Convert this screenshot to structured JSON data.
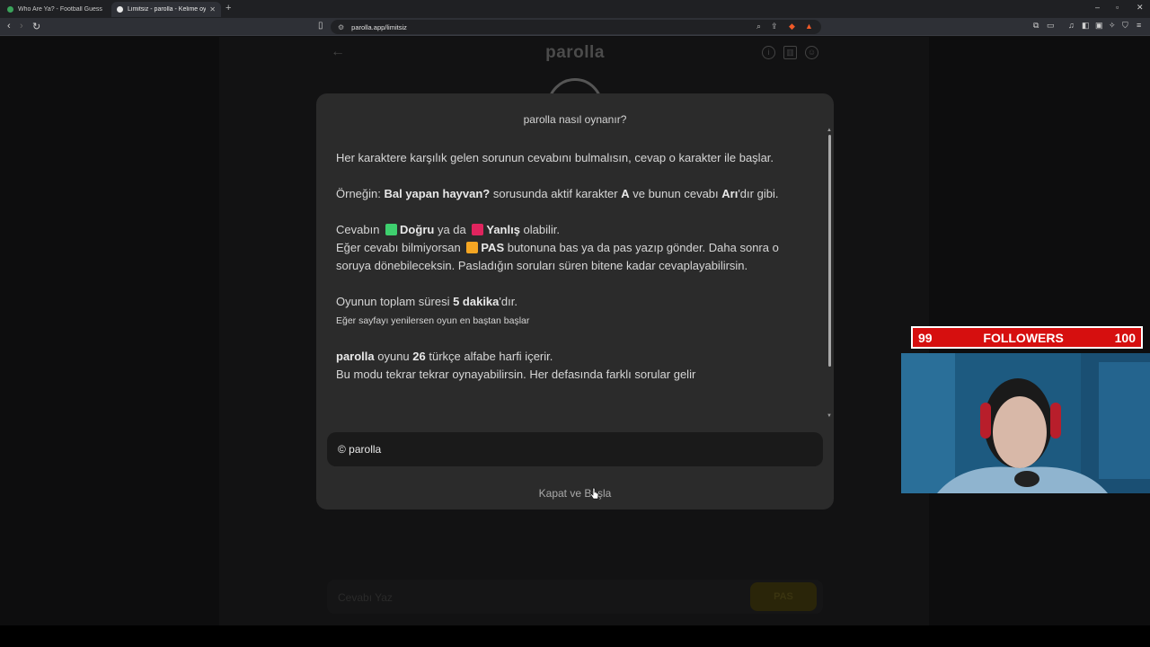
{
  "browser": {
    "tabs": [
      {
        "title": "Who Are Ya? - Football Guesser",
        "active": false
      },
      {
        "title": "Limitsiz - parolla - Kelime oyunu",
        "active": true
      }
    ],
    "url": "parolla.app/limitsiz"
  },
  "app": {
    "logo": "parolla",
    "input_placeholder": "Cevabı Yaz",
    "pas_label": "PAS"
  },
  "modal": {
    "title": "parolla nasıl oynanır?",
    "p1": "Her karaktere karşılık gelen sorunun cevabını bulmalısın, cevap o karakter ile başlar.",
    "p2": {
      "a": "Örneğin: ",
      "b": "Bal yapan hayvan?",
      "c": " sorusunda aktif karakter ",
      "d": "A",
      "e": " ve bunun cevabı ",
      "f": "Arı",
      "g": "'dır gibi."
    },
    "p3": {
      "a": "Cevabın ",
      "b": "Doğru",
      "c": " ya da ",
      "d": "Yanlış",
      "e": " olabilir.",
      "f": "Eğer cevabı bilmiyorsan ",
      "g": "PAS",
      "h": " butonuna bas ya da pas yazıp gönder. Daha sonra o soruya dönebileceksin. Pasladığın soruları süren bitene kadar cevaplayabilirsin."
    },
    "p4": {
      "a": "Oyunun toplam süresi ",
      "b": "5 dakika",
      "c": "'dır.",
      "small": "Eğer sayfayı yenilersen oyun en baştan başlar"
    },
    "p5": {
      "a": "parolla",
      "b": " oyunu ",
      "c": "26",
      "d": " türkçe alfabe harfi içerir.",
      "e": "Bu modu tekrar tekrar oynayabilirsin. Her defasında farklı sorular gelir"
    },
    "copyright": "© parolla",
    "close_button": "Kapat ve Başla"
  },
  "overlay": {
    "followers_current": "99",
    "followers_label": "FOLLOWERS",
    "followers_goal": "100"
  },
  "colors": {
    "correct": "#3ecf6e",
    "wrong": "#e0245e",
    "pas": "#f5a623",
    "followers_bar": "#d60f0f"
  }
}
